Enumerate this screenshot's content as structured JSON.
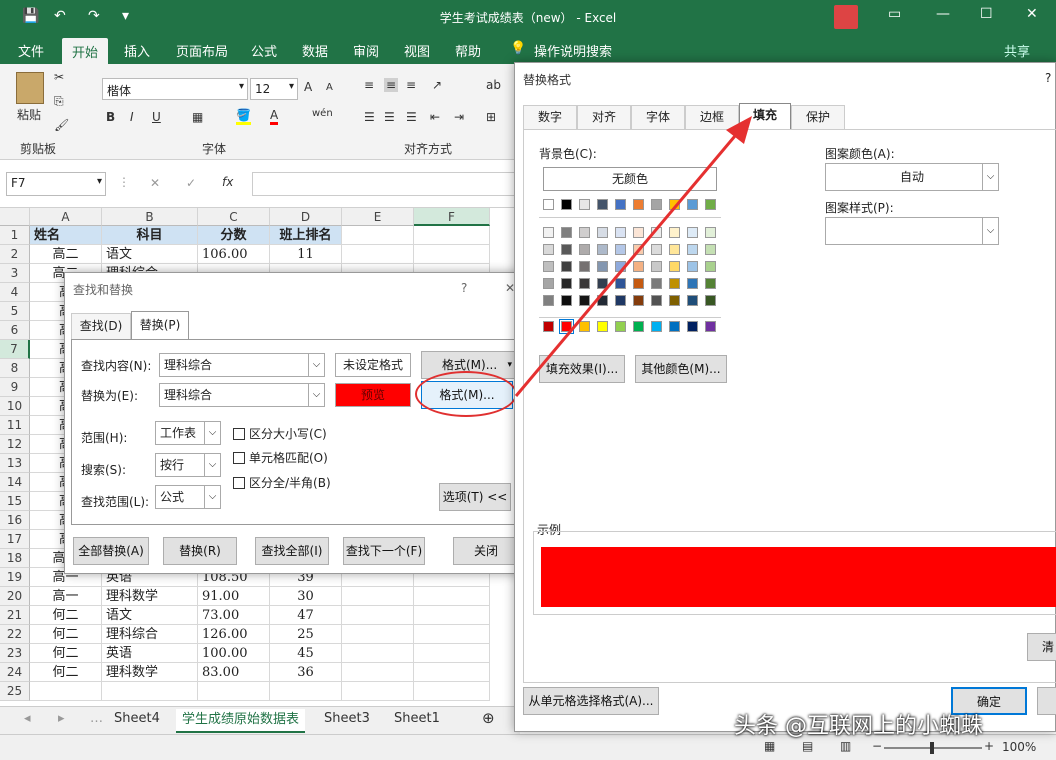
{
  "window": {
    "title": "学生考试成绩表（new） - Excel"
  },
  "qat": {
    "save": "💾",
    "undo": "↶",
    "redo": "↷",
    "more": "▾"
  },
  "ribbon_tabs": [
    "文件",
    "开始",
    "插入",
    "页面布局",
    "公式",
    "数据",
    "审阅",
    "视图",
    "帮助",
    "操作说明搜索"
  ],
  "share": "共享",
  "ribbon": {
    "paste": "粘贴",
    "clipboard": "剪贴板",
    "font_name": "楷体",
    "font_size": "12",
    "bold": "B",
    "italic": "I",
    "underline": "U",
    "font_group": "字体",
    "align_group": "对齐方式",
    "wen": "wén",
    "A_big": "A",
    "A_small": "A"
  },
  "formula": {
    "namebox": "F7",
    "fx": "fx",
    "cancel": "✕",
    "enter": "✓"
  },
  "columns": [
    "A",
    "B",
    "C",
    "D",
    "E",
    "F"
  ],
  "rows": [
    [
      "姓名",
      "科目",
      "分数",
      "班上排名"
    ],
    [
      "高二",
      "语文",
      "106.00",
      "11"
    ],
    [
      "高二",
      "理科综合",
      "",
      ""
    ],
    [
      "高",
      "",
      "",
      ""
    ],
    [
      "高",
      "",
      "",
      ""
    ],
    [
      "高",
      "",
      "",
      ""
    ],
    [
      "高",
      "",
      "",
      ""
    ],
    [
      "高",
      "",
      "",
      ""
    ],
    [
      "高",
      "",
      "",
      ""
    ],
    [
      "高",
      "",
      "",
      ""
    ],
    [
      "高",
      "",
      "",
      ""
    ],
    [
      "高",
      "",
      "",
      ""
    ],
    [
      "高",
      "",
      "",
      ""
    ],
    [
      "高",
      "",
      "",
      ""
    ],
    [
      "高",
      "",
      "",
      ""
    ],
    [
      "高",
      "",
      "",
      ""
    ],
    [
      "高",
      "",
      "",
      ""
    ],
    [
      "高一",
      "理科综合",
      "108.00",
      "36"
    ],
    [
      "高一",
      "英语",
      "108.50",
      "39"
    ],
    [
      "高一",
      "理科数学",
      "91.00",
      "30"
    ],
    [
      "何二",
      "语文",
      "73.00",
      "47"
    ],
    [
      "何二",
      "理科综合",
      "126.00",
      "25"
    ],
    [
      "何二",
      "英语",
      "100.00",
      "45"
    ],
    [
      "何二",
      "理科数学",
      "83.00",
      "36"
    ]
  ],
  "row_numbers": [
    "1",
    "2",
    "3",
    "4",
    "5",
    "6",
    "7",
    "8",
    "9",
    "10",
    "11",
    "12",
    "13",
    "14",
    "15",
    "16",
    "17",
    "18",
    "19",
    "20",
    "21",
    "22",
    "23",
    "24",
    "25"
  ],
  "sheet_tabs": [
    "Sheet4",
    "学生成绩原始数据表",
    "Sheet3",
    "Sheet1"
  ],
  "status": {
    "zoom": "100%"
  },
  "find_replace": {
    "title": "查找和替换",
    "help": "?",
    "close": "✕",
    "tabs": [
      "查找(D)",
      "替换(P)"
    ],
    "find_label": "查找内容(N):",
    "find_value": "理科综合",
    "find_format": "未设定格式",
    "format_btn": "格式(M)...",
    "replace_label": "替换为(E):",
    "replace_value": "理科综合",
    "preview": "预览",
    "format_btn2": "格式(M)...",
    "scope_label": "范围(H):",
    "scope_value": "工作表",
    "search_label": "搜索(S):",
    "search_value": "按行",
    "lookin_label": "查找范围(L):",
    "lookin_value": "公式",
    "match_case": "区分大小写(C)",
    "match_cell": "单元格匹配(O)",
    "match_width": "区分全/半角(B)",
    "options": "选项(T) <<",
    "buttons": [
      "全部替换(A)",
      "替换(R)",
      "查找全部(I)",
      "查找下一个(F)",
      "关闭"
    ]
  },
  "replace_format": {
    "title": "替换格式",
    "help": "?",
    "tabs": [
      "数字",
      "对齐",
      "字体",
      "边框",
      "填充",
      "保护"
    ],
    "bg_label": "背景色(C):",
    "no_color": "无颜色",
    "pattern_color_label": "图案颜色(A):",
    "pattern_color_value": "自动",
    "pattern_style_label": "图案样式(P):",
    "fill_effects": "填充效果(I)...",
    "more_colors": "其他颜色(M)...",
    "sample_label": "示例",
    "sample_color": "#ff0000",
    "clear": "清",
    "from_cell": "从单元格选择格式(A)...",
    "ok": "确定"
  },
  "theme_colors_row1": [
    "#ffffff",
    "#000000",
    "#e7e6e6",
    "#44546a",
    "#4472c4",
    "#ed7d31",
    "#a5a5a5",
    "#ffc000",
    "#5b9bd5",
    "#70ad47"
  ],
  "standard_colors": [
    "#c00000",
    "#ff0000",
    "#ffc000",
    "#ffff00",
    "#92d050",
    "#00b050",
    "#00b0f0",
    "#0070c0",
    "#002060",
    "#7030a0"
  ],
  "watermark": "头条 @互联网上的小蜘蛛"
}
